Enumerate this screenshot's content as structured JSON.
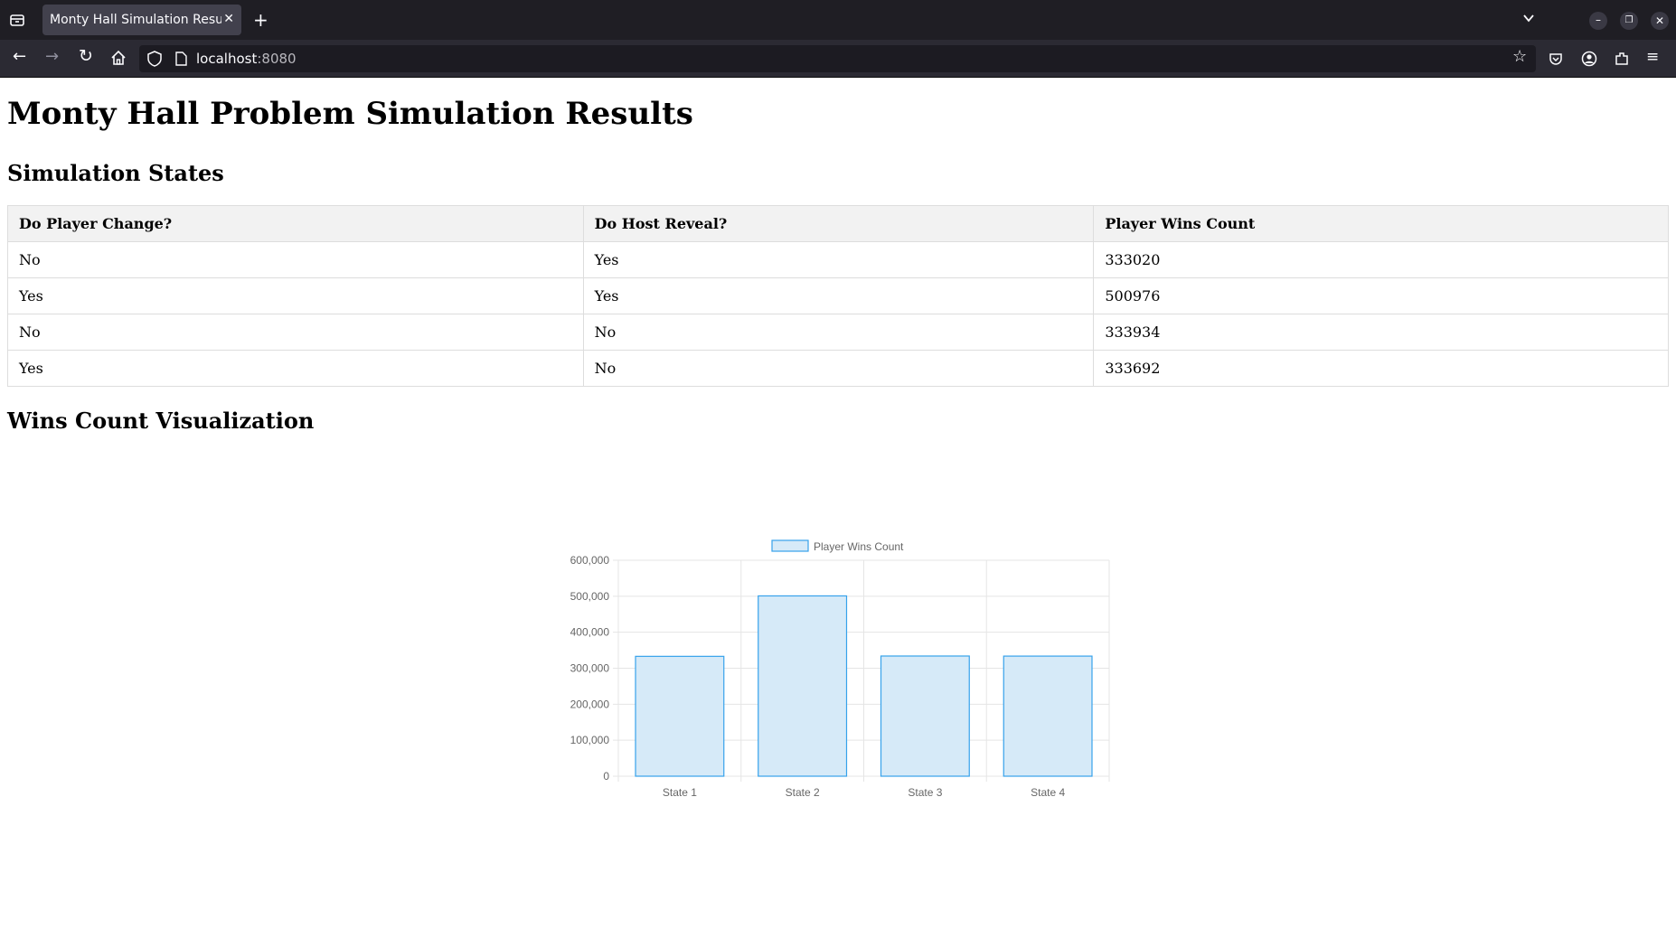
{
  "browser": {
    "tab_title": "Monty Hall Simulation Results",
    "url_host": "localhost",
    "url_port": ":8080"
  },
  "page": {
    "title": "Monty Hall Problem Simulation Results",
    "section1": "Simulation States",
    "section2": "Wins Count Visualization"
  },
  "table": {
    "headers": [
      "Do Player Change?",
      "Do Host Reveal?",
      "Player Wins Count"
    ],
    "rows": [
      [
        "No",
        "Yes",
        "333020"
      ],
      [
        "Yes",
        "Yes",
        "500976"
      ],
      [
        "No",
        "No",
        "333934"
      ],
      [
        "Yes",
        "No",
        "333692"
      ]
    ]
  },
  "chart_data": {
    "type": "bar",
    "categories": [
      "State 1",
      "State 2",
      "State 3",
      "State 4"
    ],
    "series": [
      {
        "name": "Player Wins Count",
        "values": [
          333020,
          500976,
          333934,
          333692
        ]
      }
    ],
    "ylim": [
      0,
      600000
    ],
    "yticks": [
      "0",
      "100,000",
      "200,000",
      "300,000",
      "400,000",
      "500,000",
      "600,000"
    ],
    "legend": "top",
    "grid": true,
    "colors": {
      "bar_fill": "#d6eaf8",
      "bar_border": "#36a2eb",
      "grid": "#e5e5e5",
      "tick_text": "#666666"
    }
  }
}
